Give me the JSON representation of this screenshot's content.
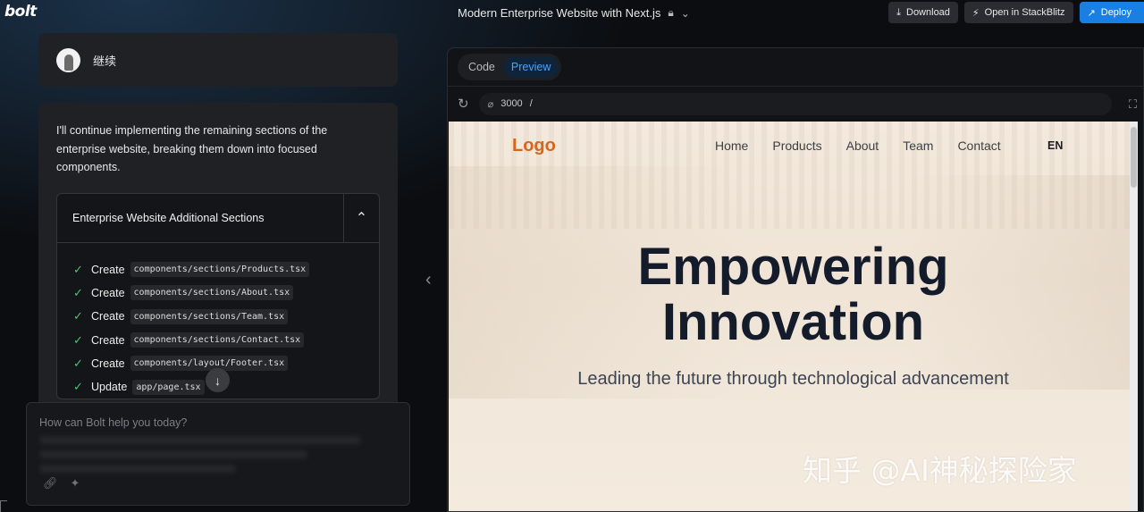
{
  "app": {
    "logo": "bolt"
  },
  "header": {
    "project_title": "Modern Enterprise Website with Next.js",
    "download_label": "Download",
    "stackblitz_label": "Open in StackBlitz",
    "deploy_label": "Deploy"
  },
  "chat": {
    "user_message": "继续",
    "assistant_message": "I'll continue implementing the remaining sections of the enterprise website, breaking them down into focused components.",
    "artifact": {
      "title": "Enterprise Website Additional Sections",
      "actions": [
        {
          "verb": "Create",
          "path": "components/sections/Products.tsx"
        },
        {
          "verb": "Create",
          "path": "components/sections/About.tsx"
        },
        {
          "verb": "Create",
          "path": "components/sections/Team.tsx"
        },
        {
          "verb": "Create",
          "path": "components/sections/Contact.tsx"
        },
        {
          "verb": "Create",
          "path": "components/layout/Footer.tsx"
        },
        {
          "verb": "Update",
          "path": "app/page.tsx"
        }
      ]
    },
    "prompt_placeholder": "How can Bolt help you today?"
  },
  "workbench": {
    "tabs": [
      "Code",
      "Preview"
    ],
    "active_tab": "Preview",
    "port": "3000",
    "path": "/"
  },
  "site": {
    "logo": "Logo",
    "nav": [
      "Home",
      "Products",
      "About",
      "Team",
      "Contact"
    ],
    "lang": "EN",
    "hero_line1": "Empowering",
    "hero_line2": "Innovation",
    "hero_sub": "Leading the future through technological advancement"
  },
  "watermark": "知乎 @AI神秘探险家",
  "colors": {
    "accent": "#1a7fe3",
    "check": "#4ec27a",
    "site_logo": "#d8651c"
  }
}
